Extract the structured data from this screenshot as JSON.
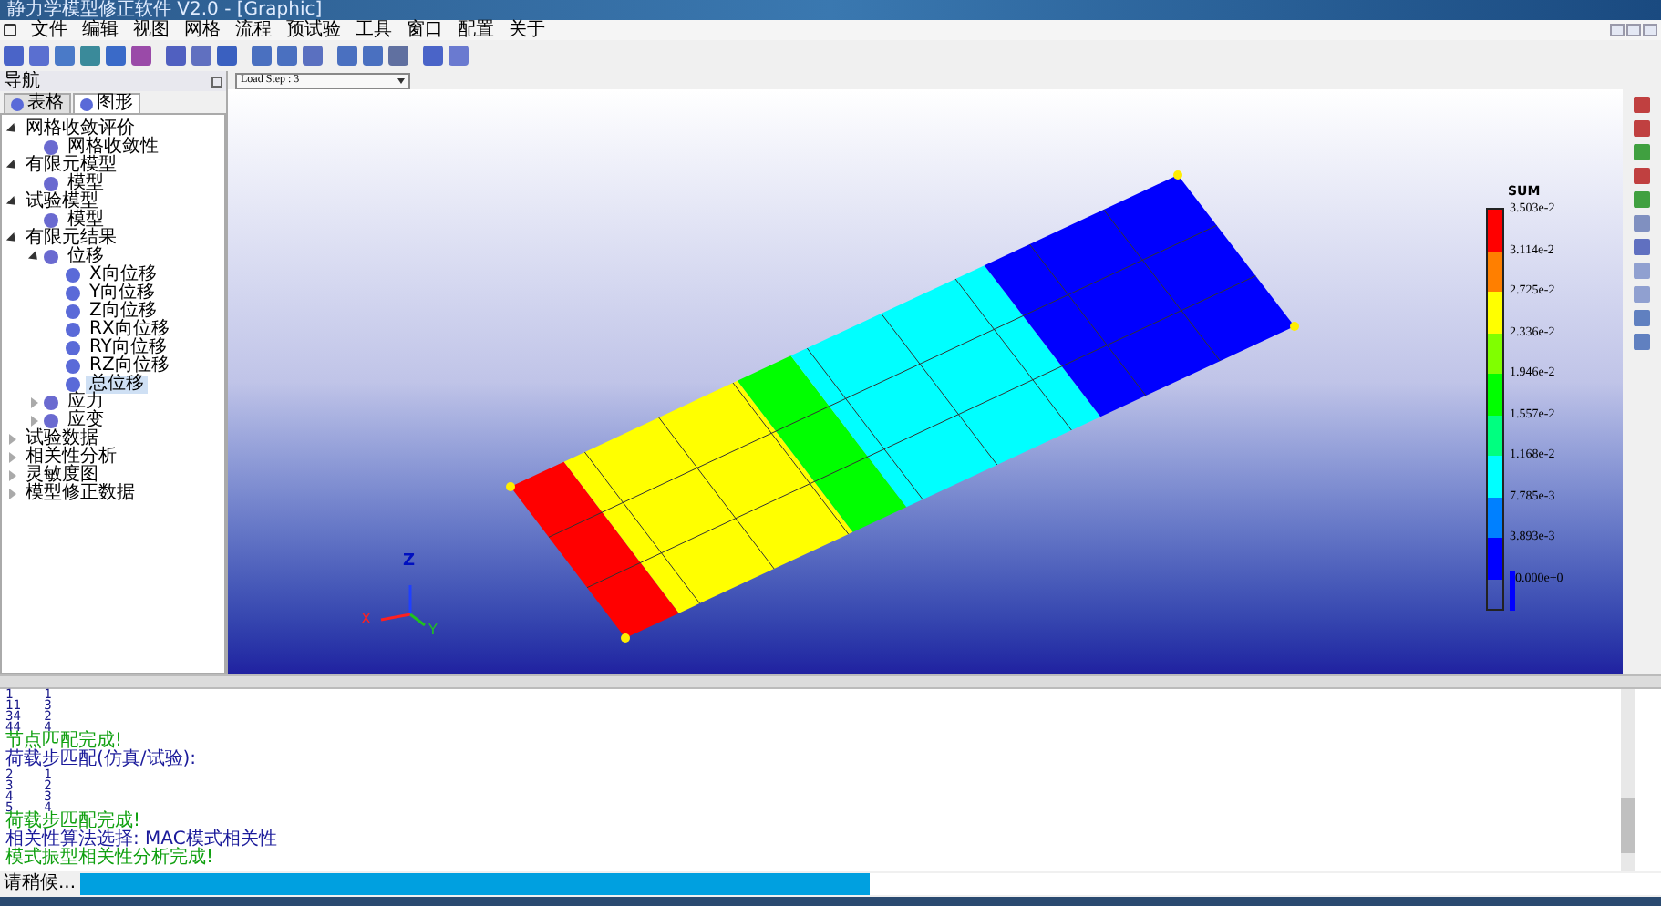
{
  "window": {
    "title": "静力学模型修正软件 V2.0 - [Graphic]"
  },
  "menu": [
    "文件",
    "编辑",
    "视图",
    "网格",
    "流程",
    "预试验",
    "工具",
    "窗口",
    "配置",
    "关于"
  ],
  "navigator": {
    "title": "导航",
    "tabs": [
      {
        "label": "表格",
        "selected": false
      },
      {
        "label": "图形",
        "selected": true
      }
    ],
    "tree": [
      {
        "label": "网格收敛评价",
        "expanded": true,
        "children": [
          {
            "label": "网格收敛性",
            "selected": false
          }
        ]
      },
      {
        "label": "有限元模型",
        "expanded": true,
        "children": [
          {
            "label": "模型",
            "selected": false
          }
        ]
      },
      {
        "label": "试验模型",
        "expanded": true,
        "children": [
          {
            "label": "模型",
            "selected": false
          }
        ]
      },
      {
        "label": "有限元结果",
        "expanded": true,
        "children": [
          {
            "label": "位移",
            "expanded": true,
            "children": [
              {
                "label": "X向位移",
                "selected": false
              },
              {
                "label": "Y向位移",
                "selected": false
              },
              {
                "label": "Z向位移",
                "selected": false
              },
              {
                "label": "RX向位移",
                "selected": false
              },
              {
                "label": "RY向位移",
                "selected": false
              },
              {
                "label": "RZ向位移",
                "selected": false
              },
              {
                "label": "总位移",
                "selected": true
              }
            ]
          },
          {
            "label": "应力",
            "expanded": false
          },
          {
            "label": "应变",
            "expanded": false
          }
        ]
      },
      {
        "label": "试验数据",
        "expanded": false
      },
      {
        "label": "相关性分析",
        "expanded": false
      },
      {
        "label": "灵敏度图",
        "expanded": false
      },
      {
        "label": "模型修正数据",
        "expanded": false
      }
    ]
  },
  "load_step": "Load Step : 3",
  "legend": {
    "title": "SUM",
    "entries": [
      {
        "label": "3.503e-2",
        "color": "#ff0000"
      },
      {
        "label": "3.114e-2",
        "color": "#ff7f00"
      },
      {
        "label": "2.725e-2",
        "color": "#ffff00"
      },
      {
        "label": "2.336e-2",
        "color": "#80ff00"
      },
      {
        "label": "1.946e-2",
        "color": "#00ff00"
      },
      {
        "label": "1.557e-2",
        "color": "#00ff80"
      },
      {
        "label": "1.168e-2",
        "color": "#00ffff"
      },
      {
        "label": "7.785e-3",
        "color": "#0080ff"
      },
      {
        "label": "3.893e-3",
        "color": "#0000ff"
      },
      {
        "label": "0.000e+0",
        "color": "#0000ff"
      }
    ]
  },
  "axes": {
    "z": "Z",
    "x": "X",
    "y": "Y"
  },
  "console": [
    {
      "text": "1    1",
      "kind": "data"
    },
    {
      "text": "11   3",
      "kind": "data"
    },
    {
      "text": "34   2",
      "kind": "data"
    },
    {
      "text": "44   4",
      "kind": "data"
    },
    {
      "text": "节点匹配完成!",
      "kind": "done"
    },
    {
      "text": "荷载步匹配(仿真/试验):",
      "kind": "info"
    },
    {
      "text": "2    1",
      "kind": "data"
    },
    {
      "text": "3    2",
      "kind": "data"
    },
    {
      "text": "4    3",
      "kind": "data"
    },
    {
      "text": "5    4",
      "kind": "data"
    },
    {
      "text": "荷载步匹配完成!",
      "kind": "done"
    },
    {
      "text": "相关性算法选择: MAC模式相关性",
      "kind": "info"
    },
    {
      "text": "模式振型相关性分析完成!",
      "kind": "done"
    }
  ],
  "status_bar": {
    "text": "请稍候...",
    "level": 0.5
  }
}
